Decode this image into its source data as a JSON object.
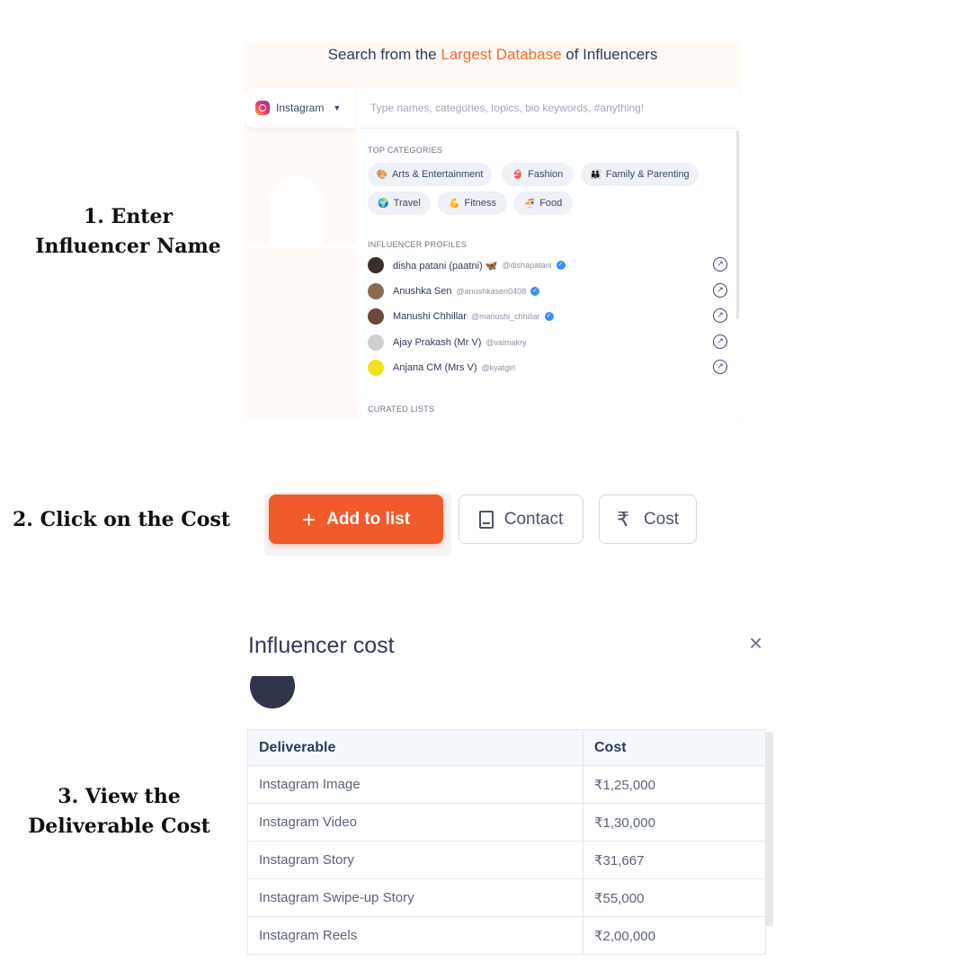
{
  "steps": [
    {
      "lines": [
        "1. Enter",
        "Influencer Name"
      ]
    },
    {
      "lines": [
        "2. Click on the Cost"
      ]
    },
    {
      "lines": [
        "3. View the",
        "Deliverable Cost"
      ]
    }
  ],
  "search": {
    "heading_prefix": "Search from the ",
    "heading_accent": "Largest Database",
    "heading_suffix": " of Influencers",
    "accent_color": "#f26a2e",
    "platform": "Instagram",
    "placeholder": "Type names, categories, topics, bio keywords, #anything!",
    "top_categories_title": "TOP CATEGORIES",
    "categories": [
      {
        "label": "Arts & Entertainment",
        "icon": "🎨"
      },
      {
        "label": "Fashion",
        "icon": "👙"
      },
      {
        "label": "Family & Parenting",
        "icon": "👪"
      },
      {
        "label": "Travel",
        "icon": "🌍"
      },
      {
        "label": "Fitness",
        "icon": "💪"
      },
      {
        "label": "Food",
        "icon": "🍜"
      }
    ],
    "profiles_title": "INFLUENCER PROFILES",
    "profiles": [
      {
        "name": "disha patani (paatni) 🦋",
        "handle": "@dishapatani",
        "verified": true,
        "avatar_color": "#3b2f2a"
      },
      {
        "name": "Anushka Sen",
        "handle": "@anushkasen0408",
        "verified": true,
        "avatar_color": "#8a6a55"
      },
      {
        "name": "Manushi Chhillar",
        "handle": "@manushi_chhillar",
        "verified": true,
        "avatar_color": "#6b4a3a"
      },
      {
        "name": "Ajay Prakash (Mr V)",
        "handle": "@valmakry",
        "verified": false,
        "avatar_color": "#cfcfcf"
      },
      {
        "name": "Anjana CM (Mrs V)",
        "handle": "@kyatgirl",
        "verified": false,
        "avatar_color": "#f2e21b"
      }
    ],
    "curated_title": "CURATED LISTS"
  },
  "actions": {
    "add_to_list": "Add to list",
    "contact": "Contact",
    "cost": "Cost",
    "add_color": "#f15a2b"
  },
  "modal": {
    "title": "Influencer cost",
    "close_glyph": "×",
    "headers": [
      "Deliverable",
      "Cost"
    ],
    "rows": [
      [
        "Instagram Image",
        "₹1,25,000"
      ],
      [
        "Instagram Video",
        "₹1,30,000"
      ],
      [
        "Instagram Story",
        "₹31,667"
      ],
      [
        "Instagram Swipe-up Story",
        "₹55,000"
      ],
      [
        "Instagram Reels",
        "₹2,00,000"
      ]
    ]
  }
}
